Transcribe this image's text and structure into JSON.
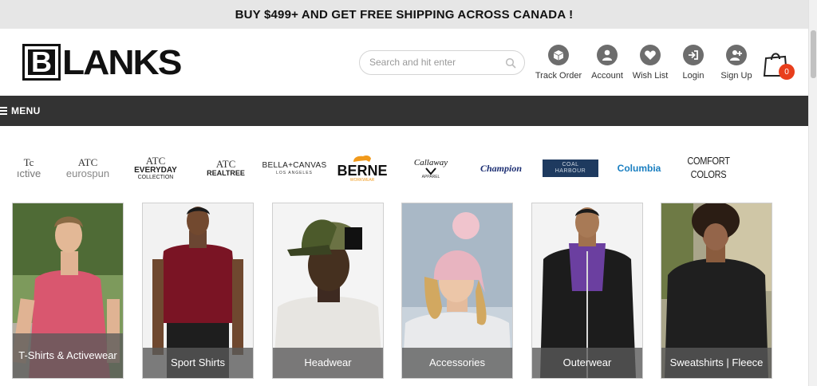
{
  "promo": {
    "text": "BUY $499+ AND GET FREE SHIPPING ACROSS CANADA !"
  },
  "header": {
    "logo": {
      "letter": "B",
      "rest": "LANKS"
    },
    "search": {
      "placeholder": "Search and hit enter",
      "value": ""
    },
    "links": [
      {
        "label": "Track Order",
        "icon": "box-icon"
      },
      {
        "label": "Account",
        "icon": "user-icon"
      },
      {
        "label": "Wish List",
        "icon": "heart-icon"
      },
      {
        "label": "Login",
        "icon": "login-icon"
      },
      {
        "label": "Sign Up",
        "icon": "add-user-icon"
      }
    ],
    "cart": {
      "count": "0",
      "badge_color": "#e83e1c"
    }
  },
  "menu": {
    "label": "MENU"
  },
  "brands": [
    {
      "t1": "Tc",
      "t2": "ıctive"
    },
    {
      "t1": "ATC",
      "t2": "eurospun"
    },
    {
      "t1": "ATC",
      "t2": "EVERYDAY",
      "t3": "COLLECTION"
    },
    {
      "t1": "ATC",
      "t2": "REALTREE"
    },
    {
      "t1": "BELLA+CANVAS",
      "t2": "LOS ANGELES"
    },
    {
      "t1": "BERNE",
      "t2": "WORKWEAR"
    },
    {
      "t1": "Callaway",
      "t2": "APPAREL"
    },
    {
      "t1": "Champion"
    },
    {
      "t1": "COAL HARBOUR"
    },
    {
      "t1": "Columbia"
    },
    {
      "t1": "COMFORT COLORS"
    }
  ],
  "categories": [
    {
      "label": "T-Shirts & Activewear"
    },
    {
      "label": "Sport Shirts"
    },
    {
      "label": "Headwear"
    },
    {
      "label": "Accessories"
    },
    {
      "label": "Outerwear"
    },
    {
      "label": "Sweatshirts | Fleece"
    }
  ],
  "colors": {
    "menubar": "#333333",
    "promo_bg": "#e6e6e6",
    "icon_gray": "#6d6d6d"
  }
}
